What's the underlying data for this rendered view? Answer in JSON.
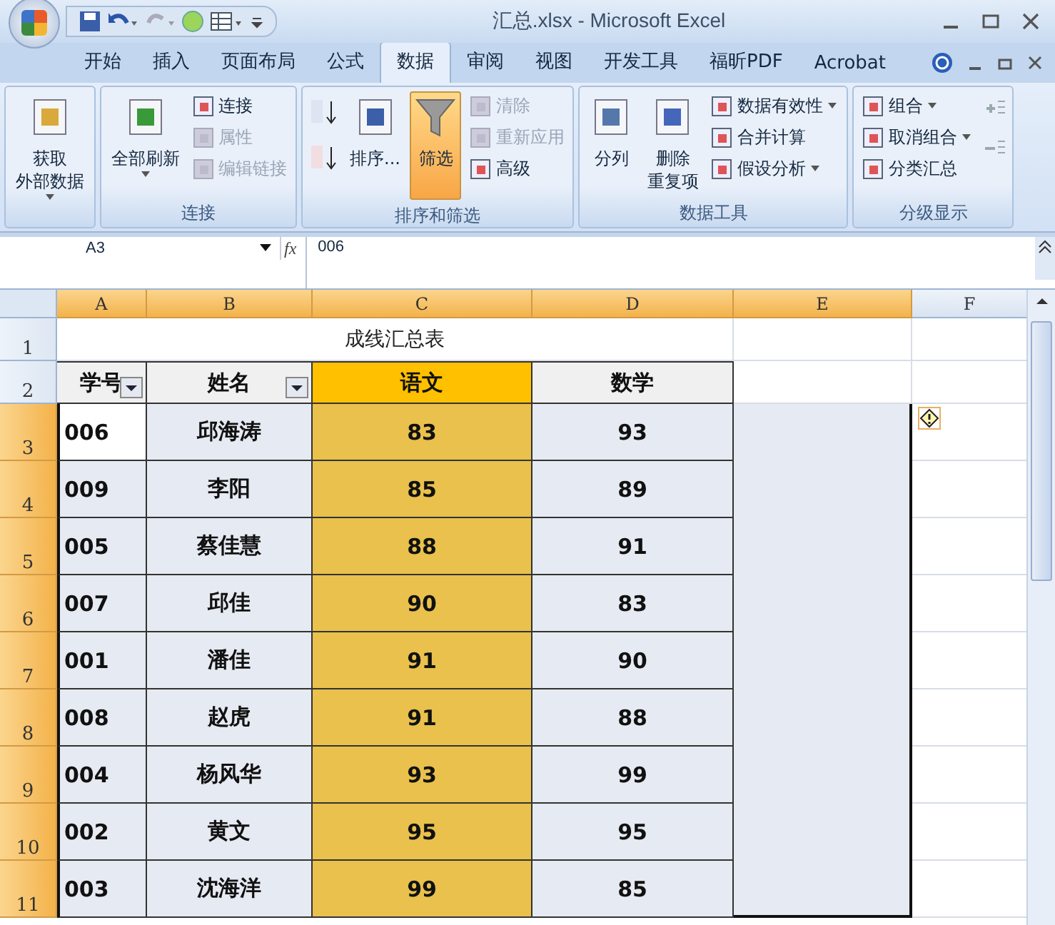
{
  "title_bar": {
    "title": "汇总.xlsx - Microsoft Excel"
  },
  "tabs": [
    {
      "label": "开始",
      "selected": false
    },
    {
      "label": "插入",
      "selected": false
    },
    {
      "label": "页面布局",
      "selected": false
    },
    {
      "label": "公式",
      "selected": false
    },
    {
      "label": "数据",
      "selected": true
    },
    {
      "label": "审阅",
      "selected": false
    },
    {
      "label": "视图",
      "selected": false
    },
    {
      "label": "开发工具",
      "selected": false
    },
    {
      "label": "福昕PDF",
      "selected": false
    },
    {
      "label": "Acrobat",
      "selected": false
    }
  ],
  "ribbon": {
    "groups": [
      {
        "columns": [
          {
            "kind": "large",
            "label": "获取",
            "label2": "外部数据",
            "has_menu": true,
            "on": false
          }
        ]
      },
      {
        "label": "连接",
        "columns": [
          {
            "kind": "large",
            "label": "全部刷新",
            "has_menu": true,
            "on": false
          },
          {
            "kind": "stack",
            "items": [
              {
                "label": "连接",
                "disabled": false,
                "has_menu": false
              },
              {
                "label": "属性",
                "disabled": true,
                "has_menu": false
              },
              {
                "label": "编辑链接",
                "disabled": true,
                "has_menu": false
              }
            ]
          }
        ]
      },
      {
        "label": "排序和筛选",
        "columns": [
          {
            "kind": "sort_pair"
          },
          {
            "kind": "large",
            "label": "排序...",
            "has_menu": false,
            "on": false
          },
          {
            "kind": "large",
            "label": "筛选",
            "has_menu": false,
            "on": true
          },
          {
            "kind": "stack",
            "items": [
              {
                "label": "清除",
                "disabled": true,
                "has_menu": false
              },
              {
                "label": "重新应用",
                "disabled": true,
                "has_menu": false
              },
              {
                "label": "高级",
                "disabled": false,
                "has_menu": false
              }
            ]
          }
        ]
      },
      {
        "label": "数据工具",
        "columns": [
          {
            "kind": "large",
            "label": "分列",
            "has_menu": false,
            "on": false
          },
          {
            "kind": "large",
            "label": "删除",
            "label2": "重复项",
            "has_menu": false,
            "on": false
          },
          {
            "kind": "stack",
            "items": [
              {
                "label": "数据有效性",
                "disabled": false,
                "has_menu": true
              },
              {
                "label": "合并计算",
                "disabled": false,
                "has_menu": false
              },
              {
                "label": "假设分析",
                "disabled": false,
                "has_menu": true
              }
            ]
          }
        ]
      },
      {
        "label": "分级显示",
        "columns": [
          {
            "kind": "stack",
            "items": [
              {
                "label": "组合",
                "disabled": false,
                "has_menu": true
              },
              {
                "label": "取消组合",
                "disabled": false,
                "has_menu": true
              },
              {
                "label": "分类汇总",
                "disabled": false,
                "has_menu": false
              }
            ]
          },
          {
            "kind": "detail_pair"
          }
        ]
      }
    ]
  },
  "name_box": {
    "value": "A3"
  },
  "formula_bar": {
    "function_label": "fx",
    "value": "006"
  },
  "columns": [
    {
      "label": "A",
      "selected": true
    },
    {
      "label": "B",
      "selected": true
    },
    {
      "label": "C",
      "selected": true
    },
    {
      "label": "D",
      "selected": true
    },
    {
      "label": "E",
      "selected": true
    },
    {
      "label": "F",
      "selected": false
    }
  ],
  "title_row": {
    "number": "1",
    "selected": false,
    "text": "成线汇总表"
  },
  "header_row": {
    "number": "2",
    "selected": false,
    "cells": [
      {
        "text": "学号",
        "filter": true,
        "highlighted": false
      },
      {
        "text": "姓名",
        "filter": true,
        "highlighted": false
      },
      {
        "text": "语文",
        "filter": false,
        "highlighted": true
      },
      {
        "text": "数学",
        "filter": false,
        "highlighted": false
      }
    ]
  },
  "rows": [
    {
      "number": "3",
      "selected": true,
      "active": true,
      "cells": [
        "006",
        "邱海涛",
        "83",
        "93"
      ]
    },
    {
      "number": "4",
      "selected": true,
      "active": false,
      "cells": [
        "009",
        "李阳",
        "85",
        "89"
      ]
    },
    {
      "number": "5",
      "selected": true,
      "active": false,
      "cells": [
        "005",
        "蔡佳慧",
        "88",
        "91"
      ]
    },
    {
      "number": "6",
      "selected": true,
      "active": false,
      "cells": [
        "007",
        "邱佳",
        "90",
        "83"
      ]
    },
    {
      "number": "7",
      "selected": true,
      "active": false,
      "cells": [
        "001",
        "潘佳",
        "91",
        "90"
      ]
    },
    {
      "number": "8",
      "selected": true,
      "active": false,
      "cells": [
        "008",
        "赵虎",
        "91",
        "88"
      ]
    },
    {
      "number": "9",
      "selected": true,
      "active": false,
      "cells": [
        "004",
        "杨风华",
        "93",
        "99"
      ]
    },
    {
      "number": "10",
      "selected": true,
      "active": false,
      "cells": [
        "002",
        "黄文",
        "95",
        "95"
      ]
    },
    {
      "number": "11",
      "selected": true,
      "active": false,
      "cells": [
        "003",
        "沈海洋",
        "99",
        "85"
      ]
    }
  ]
}
